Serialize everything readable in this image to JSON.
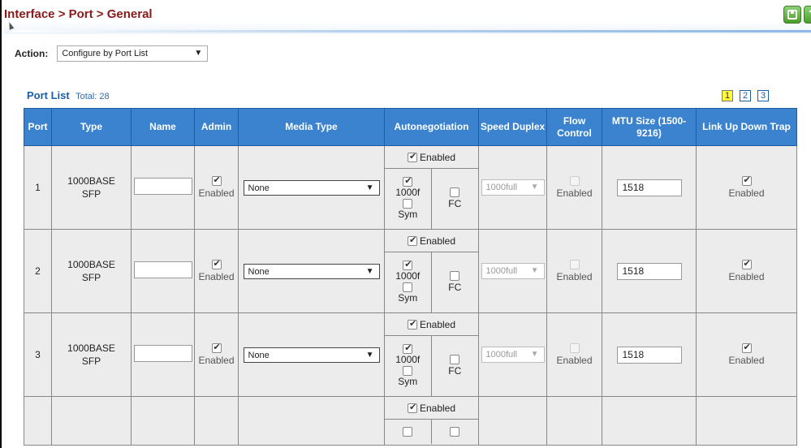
{
  "header": {
    "breadcrumb": "Interface > Port > General",
    "save_icon": "save-icon",
    "help_label": "?"
  },
  "action": {
    "label": "Action:",
    "selected": "Configure by Port List",
    "arrow": "▼"
  },
  "portlist": {
    "title": "Port List",
    "total": "Total: 28",
    "pages": [
      "1",
      "2",
      "3"
    ],
    "active_page": "1"
  },
  "columns": [
    "Port",
    "Type",
    "Name",
    "Admin",
    "Media Type",
    "Autonegotiation",
    "Speed Duplex",
    "Flow Control",
    "MTU Size (1500-9216)",
    "Link Up Down Trap"
  ],
  "rows": [
    {
      "port": "1",
      "type": "1000BASE SFP",
      "admin": "Enabled",
      "media": "None",
      "auto": "Enabled",
      "auto_1000f": "1000f",
      "auto_fc": "FC",
      "auto_sym": "Sym",
      "speed": "1000full",
      "flow": "Enabled",
      "mtu": "1518",
      "trap": "Enabled"
    },
    {
      "port": "2",
      "type": "1000BASE SFP",
      "admin": "Enabled",
      "media": "None",
      "auto": "Enabled",
      "auto_1000f": "1000f",
      "auto_fc": "FC",
      "auto_sym": "Sym",
      "speed": "1000full",
      "flow": "Enabled",
      "mtu": "1518",
      "trap": "Enabled"
    },
    {
      "port": "3",
      "type": "1000BASE SFP",
      "admin": "Enabled",
      "media": "None",
      "auto": "Enabled",
      "auto_1000f": "1000f",
      "auto_fc": "FC",
      "auto_sym": "Sym",
      "speed": "1000full",
      "flow": "Enabled",
      "mtu": "1518",
      "trap": "Enabled"
    }
  ],
  "partial_row": {
    "auto": "Enabled"
  },
  "colors": {
    "header_bg": "#3b83cf",
    "breadcrumb": "#8a1a1a",
    "link": "#1a5fa8",
    "row_bg": "#ececec",
    "button_green": "#4b9d2c"
  }
}
